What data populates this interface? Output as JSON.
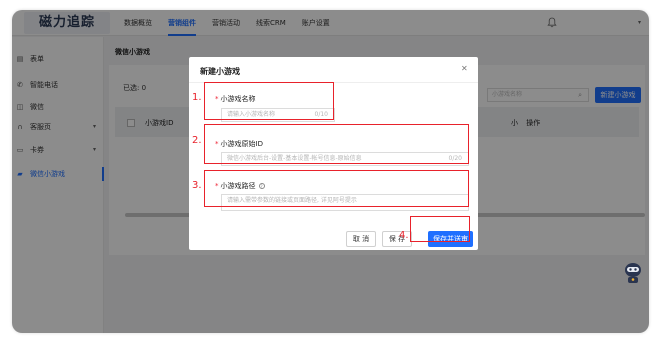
{
  "app": {
    "logo": "磁力追踪"
  },
  "nav": {
    "items": [
      "数据概览",
      "营销组件",
      "营销活动",
      "线索CRM",
      "账户设置"
    ],
    "active_index": 1
  },
  "sidebar": {
    "items": [
      {
        "label": "表单",
        "icon": "form-icon",
        "has_chevron": false
      },
      {
        "label": "智能电话",
        "icon": "phone-icon",
        "has_chevron": false
      },
      {
        "label": "微信",
        "icon": "wechat-icon",
        "has_chevron": false
      },
      {
        "label": "客服页",
        "icon": "headset-icon",
        "has_chevron": true
      },
      {
        "label": "卡券",
        "icon": "coupon-icon",
        "has_chevron": true
      },
      {
        "label": "微信小游戏",
        "icon": "game-icon",
        "has_chevron": false,
        "active": true
      }
    ]
  },
  "page": {
    "title": "微信小游戏",
    "selected_label": "已选: 0",
    "search_placeholder": "小游戏名称",
    "new_button": "新建小游戏",
    "table_headers": {
      "id": "小游戏ID",
      "ops_prefix": "小",
      "ops": "操作"
    }
  },
  "dialog": {
    "title": "新建小游戏",
    "fields": [
      {
        "label": "小游戏名称",
        "placeholder": "请输入小游戏名称",
        "count": "0/10"
      },
      {
        "label": "小游戏原始ID",
        "placeholder": "微信小游戏后台-设置-基本设置-帐号信息-原始信息",
        "count": "0/20"
      },
      {
        "label": "小游戏路径",
        "placeholder": "请输入需带参数的链接或页面路径, 详见阿号提示",
        "count": ""
      }
    ],
    "buttons": {
      "cancel": "取 消",
      "save": "保 存",
      "save_submit": "保存并送审"
    }
  },
  "annotations": [
    "1.",
    "2.",
    "3.",
    "4."
  ],
  "colors": {
    "primary": "#1f6fff",
    "annotation": "#e8222b",
    "overlay": "rgba(0,0,0,0.45)"
  }
}
